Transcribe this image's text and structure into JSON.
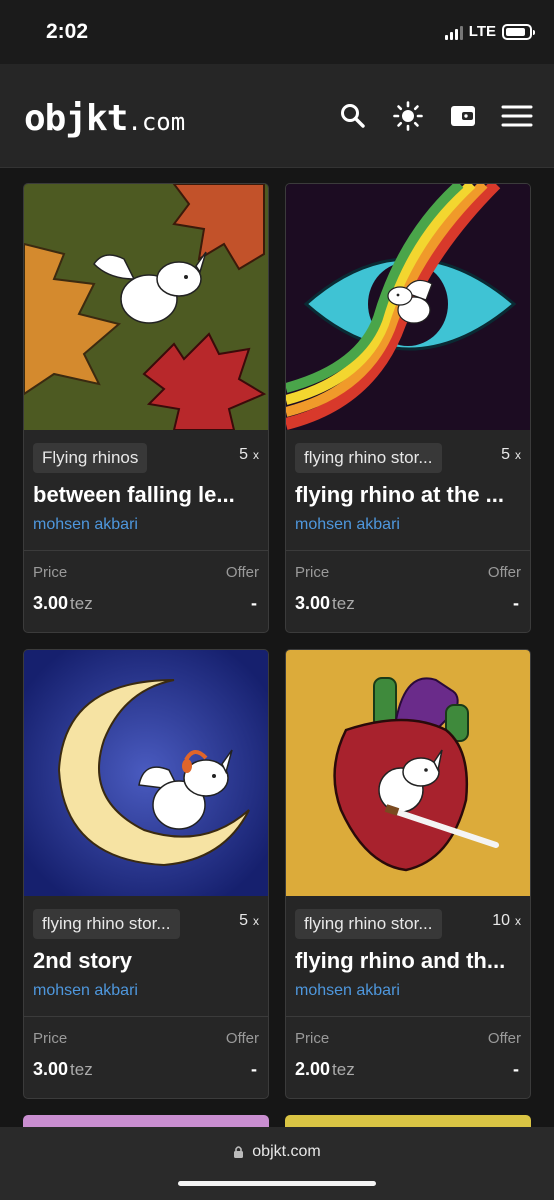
{
  "status_bar": {
    "time": "2:02",
    "network": "LTE",
    "battery_level": 0.8
  },
  "header": {
    "logo_main": "objkt",
    "logo_tld": ".com",
    "icons": [
      "search-icon",
      "theme-sun-icon",
      "wallet-icon",
      "menu-icon"
    ]
  },
  "labels": {
    "price": "Price",
    "offer": "Offer",
    "currency": "tez",
    "edition_suffix": "x"
  },
  "cards": [
    {
      "collection": "Flying rhinos",
      "editions": "5",
      "title": "between falling le...",
      "artist": "mohsen akbari",
      "price": "3.00",
      "offer": "-"
    },
    {
      "collection": "flying rhino stor...",
      "editions": "5",
      "title": "flying rhino at the ...",
      "artist": "mohsen akbari",
      "price": "3.00",
      "offer": "-"
    },
    {
      "collection": "flying rhino stor...",
      "editions": "5",
      "title": "2nd story",
      "artist": "mohsen akbari",
      "price": "3.00",
      "offer": "-"
    },
    {
      "collection": "flying rhino stor...",
      "editions": "10",
      "title": "flying rhino and th...",
      "artist": "mohsen akbari",
      "price": "2.00",
      "offer": "-"
    }
  ],
  "browser": {
    "url": "objkt.com"
  },
  "colors": {
    "background": "#161616",
    "card": "#262626",
    "artist_link": "#4e97dd"
  }
}
